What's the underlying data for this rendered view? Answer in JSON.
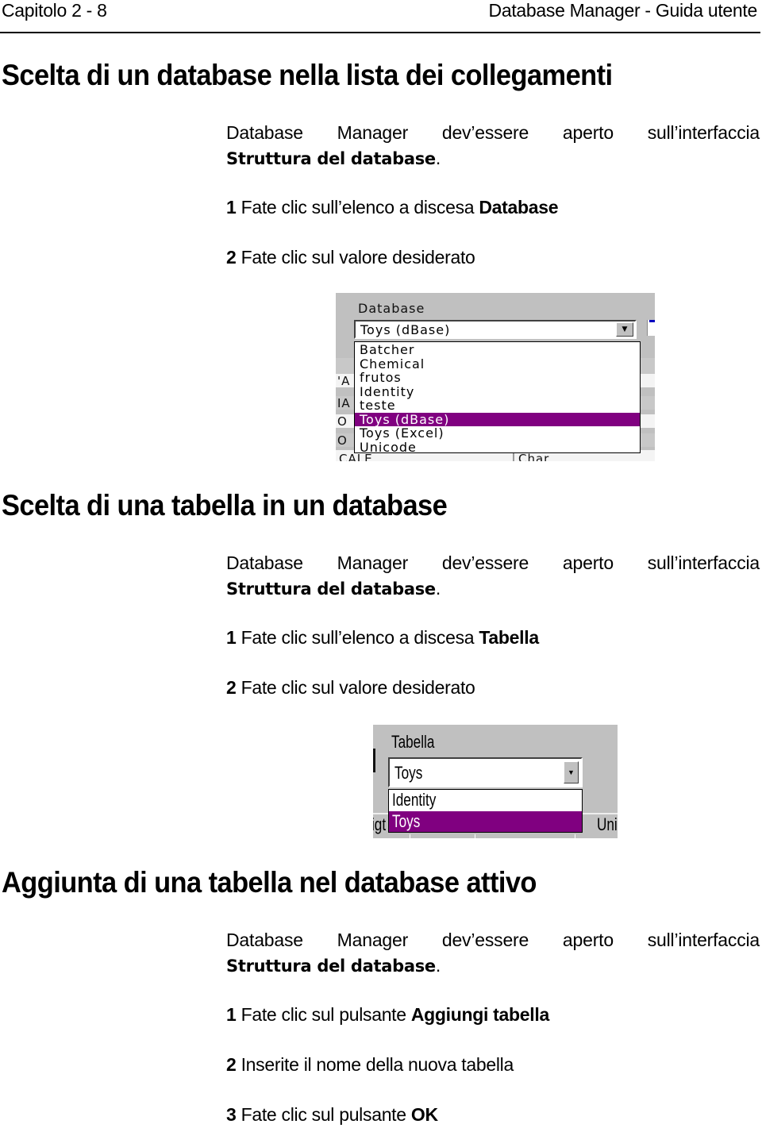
{
  "header": {
    "left": "Capitolo 2 - 8",
    "right": "Database Manager - Guida utente"
  },
  "sections": [
    {
      "title": "Scelta di un database nella lista dei collegamenti",
      "intro_words": [
        "Database",
        "Manager",
        "dev’essere",
        "aperto",
        "sull’interfaccia"
      ],
      "intro_bold": "Struttura del database",
      "intro_end": ".",
      "steps": [
        {
          "num": "1",
          "text": "Fate clic sull’elenco a discesa ",
          "bold": "Database"
        },
        {
          "num": "2",
          "text": " Fate clic sul valore desiderato",
          "bold": ""
        }
      ],
      "screenshot": {
        "label": "Database",
        "selected_value": "Toys (dBase)",
        "options": [
          "Batcher",
          "Chemical",
          "frutos",
          "Identity",
          "teste",
          "Toys (dBase)",
          "Toys (Excel)",
          "Unicode"
        ],
        "highlighted_index": 5,
        "background_cells": [
          "'A",
          "IA",
          "O",
          "O"
        ],
        "bottom_left": "CALE",
        "bottom_right": "Char"
      }
    },
    {
      "title": "Scelta di una tabella in un database",
      "intro_words": [
        "Database",
        "Manager",
        "dev’essere",
        "aperto",
        "sull’interfaccia"
      ],
      "intro_bold": "Struttura del database",
      "intro_end": ".",
      "steps": [
        {
          "num": "1",
          "text": "Fate clic sull’elenco a discesa ",
          "bold": "Tabella"
        },
        {
          "num": "2",
          "text": " Fate clic sul valore desiderato",
          "bold": ""
        }
      ],
      "screenshot": {
        "label": "Tabella",
        "selected_value": "Toys",
        "options": [
          "Identity",
          "Toys"
        ],
        "highlighted_index": 1,
        "edge_left": "igt",
        "edge_right": "Uni"
      }
    },
    {
      "title": "Aggiunta di una tabella nel database attivo",
      "intro_words": [
        "Database",
        "Manager",
        "dev’essere",
        "aperto",
        "sull’interfaccia"
      ],
      "intro_bold": "Struttura del database",
      "intro_end": ".",
      "steps": [
        {
          "num": "1",
          "text": "Fate clic sul pulsante ",
          "bold": "Aggiungi tabella"
        },
        {
          "num": "2",
          "text": " Inserite il nome della nuova tabella",
          "bold": ""
        },
        {
          "num": "3",
          "text": " Fate clic sul pulsante ",
          "bold": "OK"
        }
      ]
    }
  ],
  "colors": {
    "selection": "#800080",
    "dialog_gray": "#c0c0c0"
  }
}
